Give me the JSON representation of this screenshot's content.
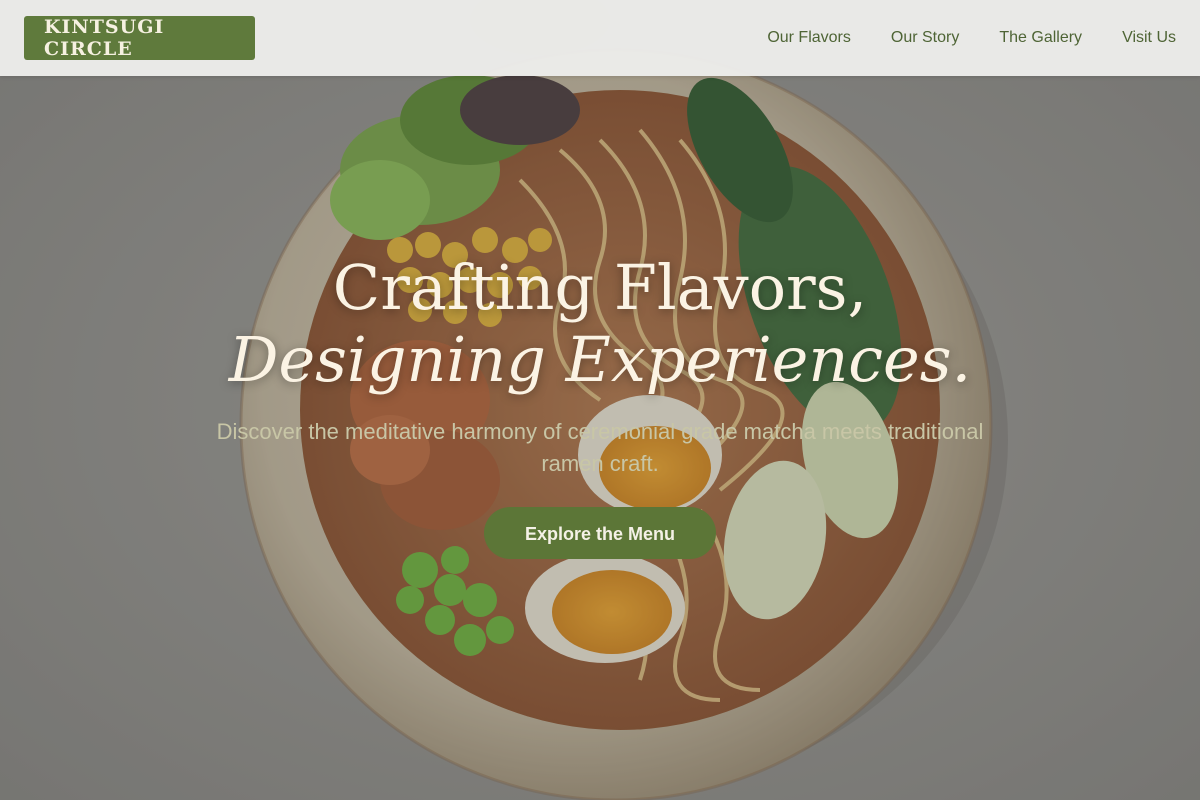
{
  "brand": {
    "name": "KINTSUGI CIRCLE"
  },
  "nav": {
    "items": [
      {
        "label": "Our Flavors"
      },
      {
        "label": "Our Story"
      },
      {
        "label": "The Gallery"
      },
      {
        "label": "Visit Us"
      }
    ]
  },
  "hero": {
    "headline_line1": "Crafting Flavors,",
    "headline_line2": "Designing Experiences.",
    "subtext": "Discover the meditative harmony of ceremonial grade matcha meets traditional ramen craft.",
    "cta_label": "Explore the Menu"
  },
  "colors": {
    "brand_green": "#5f7a3c",
    "nav_text": "#4e6435",
    "headline": "#fbf3e4",
    "subtext": "#c8c6a6",
    "cta_bg": "#5c7637"
  }
}
